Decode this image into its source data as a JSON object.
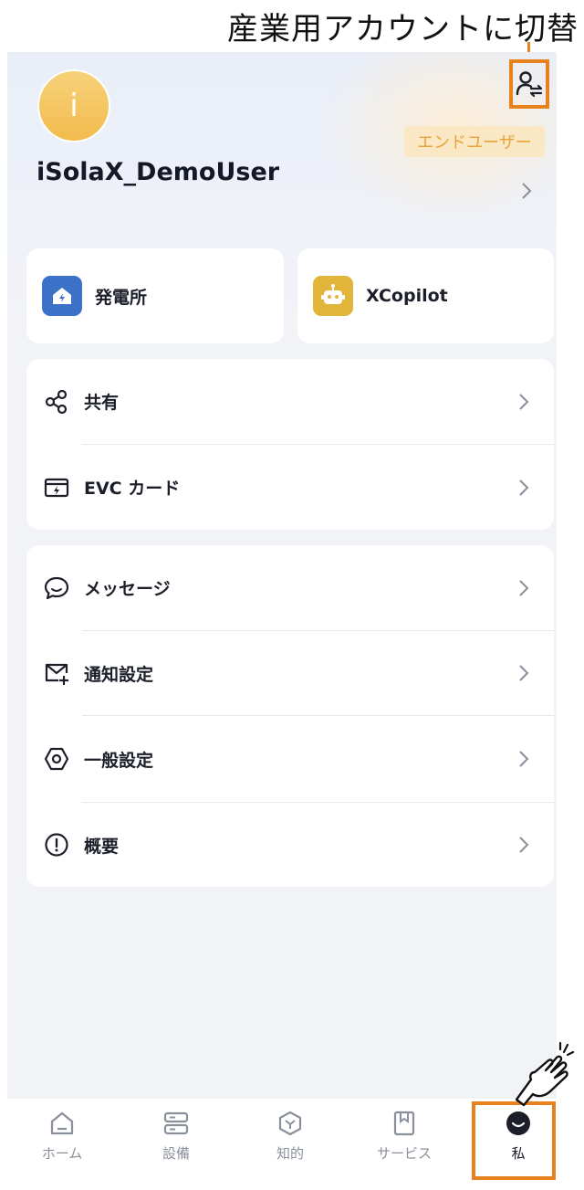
{
  "annotation": {
    "title": "産業用アカウントに切替"
  },
  "profile": {
    "avatar_letter": "i",
    "username": "iSolaX_DemoUser",
    "role_badge": "エンドユーザー"
  },
  "quick_actions": [
    {
      "label": "発電所",
      "icon": "power-station-icon",
      "color": "#3b72c8"
    },
    {
      "label": "XCopilot",
      "icon": "robot-icon",
      "color": "#e1b53a"
    }
  ],
  "menu_group_1": [
    {
      "label": "共有",
      "icon": "share-icon"
    },
    {
      "label": "EVC カード",
      "icon": "evc-card-icon"
    }
  ],
  "menu_group_2": [
    {
      "label": "メッセージ",
      "icon": "message-icon"
    },
    {
      "label": "通知設定",
      "icon": "notification-settings-icon"
    },
    {
      "label": "一般設定",
      "icon": "general-settings-icon"
    },
    {
      "label": "概要",
      "icon": "info-icon"
    }
  ],
  "tabs": [
    {
      "label": "ホーム",
      "icon": "home-icon"
    },
    {
      "label": "設備",
      "icon": "devices-icon"
    },
    {
      "label": "知的",
      "icon": "intelligence-icon"
    },
    {
      "label": "サービス",
      "icon": "service-icon"
    },
    {
      "label": "私",
      "icon": "me-icon",
      "active": true
    }
  ],
  "colors": {
    "accent_orange": "#e8821e",
    "badge_bg": "#fae7c4",
    "badge_text": "#e8a33a"
  }
}
